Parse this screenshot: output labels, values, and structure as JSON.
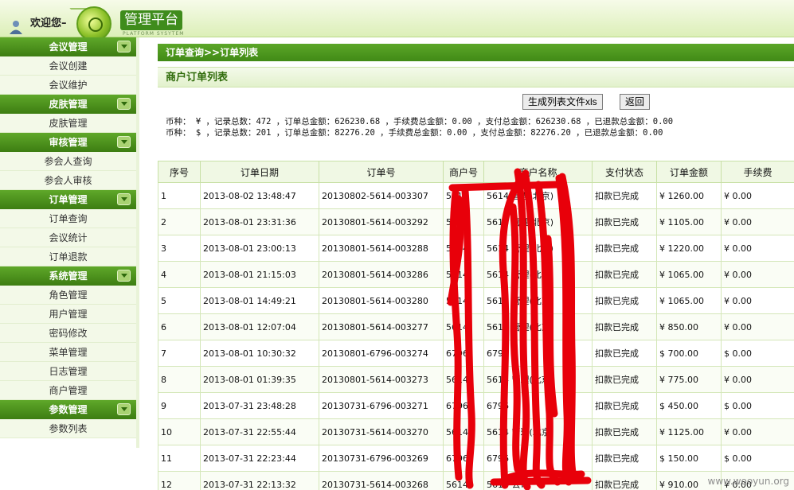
{
  "header": {
    "welcome": "欢迎您–",
    "user_name": "",
    "logo_title": "管理平台",
    "logo_subtitle": "PLATFORM SYSYTEM"
  },
  "sidebar": {
    "groups": [
      {
        "title": "会议管理",
        "items": [
          "会议创建",
          "会议维护"
        ]
      },
      {
        "title": "皮肤管理",
        "items": [
          "皮肤管理"
        ]
      },
      {
        "title": "审核管理",
        "items": [
          "参会人查询",
          "参会人审核"
        ]
      },
      {
        "title": "订单管理",
        "items": [
          "订单查询",
          "会议统计",
          "订单退款"
        ]
      },
      {
        "title": "系统管理",
        "items": [
          "角色管理",
          "用户管理",
          "密码修改",
          "菜单管理",
          "日志管理",
          "商户管理"
        ]
      },
      {
        "title": "参数管理",
        "items": [
          "参数列表"
        ]
      }
    ]
  },
  "main": {
    "breadcrumb": "订单查询>>订单列表",
    "title": "商户订单列表",
    "export_button": "生成列表文件xls",
    "back_button": "返回",
    "summary_1": "币种： ¥ ，记录总数：472 ，订单总金额：626230.68 ，手续费总金额：0.00 ，支付总金额：626230.68 ，已退款总金额：0.00",
    "summary_2": "币种： $ ，记录总数：201 ，订单总金额：82276.20 ，手续费总金额：0.00 ，支付总金额：82276.20 ，已退款总金额：0.00"
  },
  "table": {
    "columns": [
      "序号",
      "订单日期",
      "订单号",
      "商户号",
      "商户名称",
      "支付状态",
      "订单金额",
      "手续费"
    ],
    "rows": [
      [
        "1",
        "2013-08-02 13:48:47",
        "20130802-5614-003307",
        "5614",
        "5614 管理(北京)",
        "扣款已完成",
        "¥ 1260.00",
        "¥ 0.00"
      ],
      [
        "2",
        "2013-08-01 23:31:36",
        "20130801-5614-003292",
        "5614",
        "5614 管理(北京)",
        "扣款已完成",
        "¥ 1105.00",
        "¥ 0.00"
      ],
      [
        "3",
        "2013-08-01 23:00:13",
        "20130801-5614-003288",
        "5614",
        "5614 管理(北京)",
        "扣款已完成",
        "¥ 1220.00",
        "¥ 0.00"
      ],
      [
        "4",
        "2013-08-01 21:15:03",
        "20130801-5614-003286",
        "5614",
        "5614 管理(北京)",
        "扣款已完成",
        "¥ 1065.00",
        "¥ 0.00"
      ],
      [
        "5",
        "2013-08-01 14:49:21",
        "20130801-5614-003280",
        "5614",
        "5614 管理(北京)",
        "扣款已完成",
        "¥ 1065.00",
        "¥ 0.00"
      ],
      [
        "6",
        "2013-08-01 12:07:04",
        "20130801-5614-003277",
        "5614",
        "5614 管理(北京)",
        "扣款已完成",
        "¥ 850.00",
        "¥ 0.00"
      ],
      [
        "7",
        "2013-08-01 10:30:32",
        "20130801-6796-003274",
        "6796",
        "6796",
        "扣款已完成",
        "$ 700.00",
        "$ 0.00"
      ],
      [
        "8",
        "2013-08-01 01:39:35",
        "20130801-5614-003273",
        "5614",
        "5614 管理(北京)",
        "扣款已完成",
        "¥ 775.00",
        "¥ 0.00"
      ],
      [
        "9",
        "2013-07-31 23:48:28",
        "20130731-6796-003271",
        "6796",
        "6796",
        "扣款已完成",
        "$ 450.00",
        "$ 0.00"
      ],
      [
        "10",
        "2013-07-31 22:55:44",
        "20130731-5614-003270",
        "5614",
        "5614 管理(北京)",
        "扣款已完成",
        "¥ 1125.00",
        "¥ 0.00"
      ],
      [
        "11",
        "2013-07-31 22:23:44",
        "20130731-6796-003269",
        "6796",
        "6796",
        "扣款已完成",
        "$ 150.00",
        "$ 0.00"
      ],
      [
        "12",
        "2013-07-31 22:13:32",
        "20130731-5614-003268",
        "5614",
        "5614 公司",
        "扣款已完成",
        "¥ 910.00",
        "¥ 0.00"
      ]
    ]
  },
  "watermark": "www.wooyun.org",
  "colors": {
    "brand_green": "#418a16",
    "redaction": "#e8000a"
  }
}
